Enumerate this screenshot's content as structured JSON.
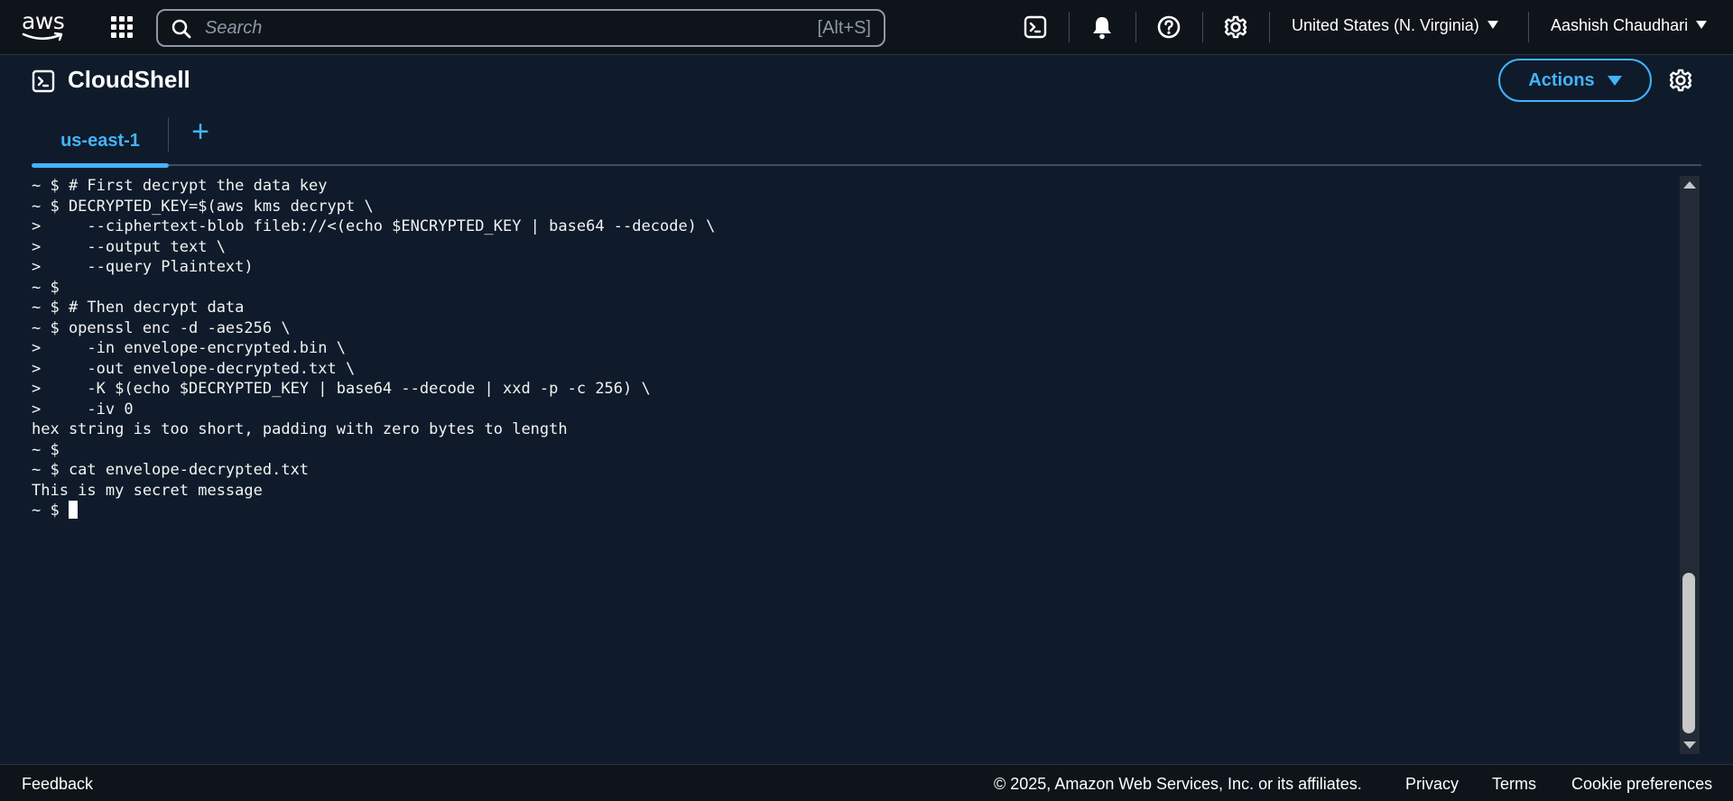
{
  "topnav": {
    "logo_text": "aws",
    "search_placeholder": "Search",
    "search_shortcut": "[Alt+S]",
    "region": "United States (N. Virginia)",
    "user": "Aashish Chaudhari"
  },
  "cloudshell": {
    "title": "CloudShell",
    "actions_label": "Actions"
  },
  "tabs": [
    {
      "label": "us-east-1",
      "active": true
    }
  ],
  "tab_add_label": "+",
  "terminal": {
    "lines": [
      "~ $ # First decrypt the data key",
      "~ $ DECRYPTED_KEY=$(aws kms decrypt \\",
      ">     --ciphertext-blob fileb://<(echo $ENCRYPTED_KEY | base64 --decode) \\",
      ">     --output text \\",
      ">     --query Plaintext)",
      "~ $",
      "~ $ # Then decrypt data",
      "~ $ openssl enc -d -aes256 \\",
      ">     -in envelope-encrypted.bin \\",
      ">     -out envelope-decrypted.txt \\",
      ">     -K $(echo $DECRYPTED_KEY | base64 --decode | xxd -p -c 256) \\",
      ">     -iv 0",
      "hex string is too short, padding with zero bytes to length",
      "~ $",
      "~ $ cat envelope-decrypted.txt",
      "This is my secret message"
    ],
    "prompt": "~ $ "
  },
  "footer": {
    "feedback": "Feedback",
    "copyright": "© 2025, Amazon Web Services, Inc. or its affiliates.",
    "privacy": "Privacy",
    "terms": "Terms",
    "cookies": "Cookie preferences"
  },
  "colors": {
    "accent": "#42b4ff",
    "background": "#0f1b2a",
    "nav_background": "#0f141a"
  },
  "icons": {
    "logo": "aws-logo",
    "apps": "grid-icon",
    "search": "search-icon",
    "cloudshell": "terminal-icon",
    "notifications": "bell-icon",
    "help": "help-icon",
    "settings": "gear-icon"
  }
}
